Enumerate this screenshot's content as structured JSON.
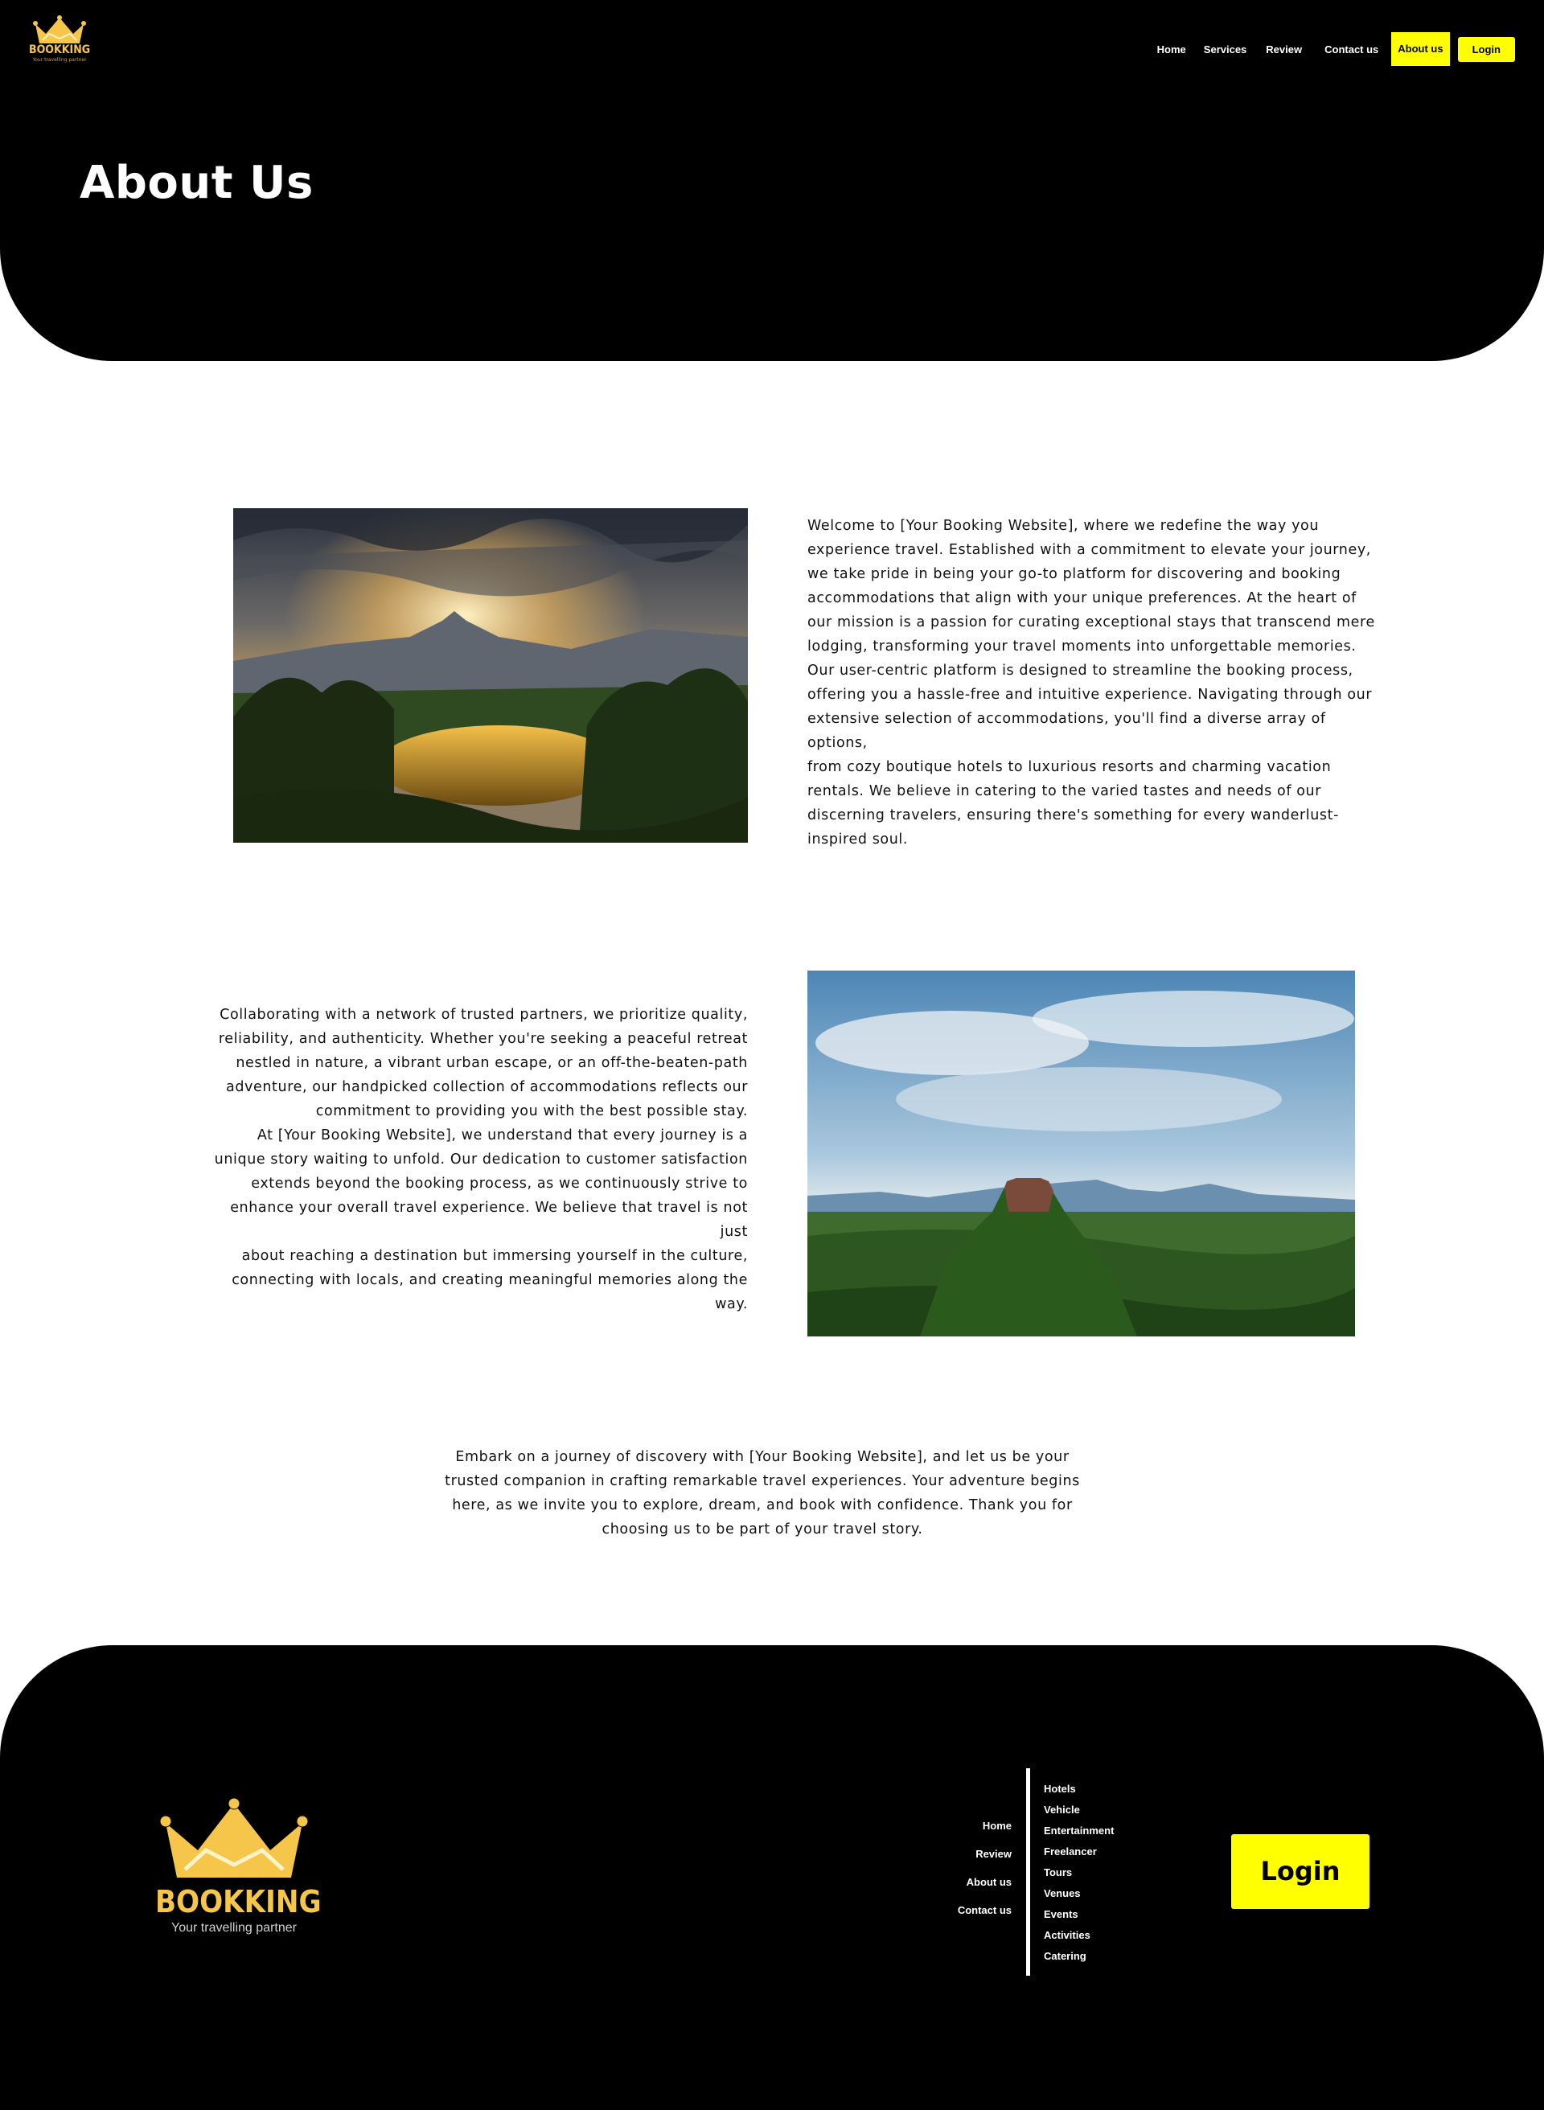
{
  "brand": {
    "name": "BOOKKING",
    "tagline": "Your travelling partner",
    "color": "#f6c64a"
  },
  "nav": {
    "home": "Home",
    "services": "Services",
    "review": "Review",
    "contact": "Contact us",
    "about": "About us",
    "login": "Login",
    "accent": "#ffff00"
  },
  "hero": {
    "title": "About Us"
  },
  "sections": {
    "intro": [
      "Welcome to [Your Booking Website], where we redefine the way you",
      "experience travel. Established with a commitment to elevate your journey,",
      "we take pride in being your go-to platform for discovering and booking",
      "accommodations that align with your unique preferences. At the heart of",
      "our mission is a passion for curating exceptional stays that transcend mere",
      "lodging, transforming your travel moments into unforgettable memories.",
      "Our user-centric platform is designed to streamline the booking process,",
      "offering you a hassle-free and intuitive experience. Navigating through our",
      "extensive selection of accommodations, you'll find a diverse array of options,",
      "from cozy boutique hotels to luxurious resorts and charming vacation",
      "rentals. We believe in catering to the varied tastes and needs of our",
      "discerning travelers, ensuring there's something for every wanderlust-",
      "inspired soul."
    ],
    "partners": [
      "Collaborating with a network of trusted partners, we prioritize quality,",
      "reliability, and authenticity. Whether you're seeking a peaceful retreat",
      "nestled in nature, a vibrant urban escape, or an off-the-beaten-path",
      "adventure, our handpicked collection of accommodations reflects our",
      "commitment to providing you with the best possible stay.",
      "At [Your Booking Website], we understand that every journey is a",
      "unique story waiting to unfold. Our dedication to customer satisfaction",
      "extends beyond the booking process, as we continuously strive to",
      "enhance your overall travel experience. We believe that travel is not just",
      "about reaching a destination but immersing yourself in the culture,",
      "connecting with locals, and creating meaningful memories along the",
      "way."
    ],
    "closing": [
      "Embark on a journey of discovery with [Your Booking Website], and let us be your",
      "trusted companion in crafting remarkable travel experiences. Your adventure begins",
      "here, as we invite you to explore, dream, and book with confidence. Thank you for",
      "choosing us to be part of your travel story."
    ]
  },
  "footer": {
    "left_links": [
      "Home",
      "Review",
      "About us",
      "Contact us"
    ],
    "right_links": [
      "Hotels",
      "Vehicle",
      "Entertainment",
      "Freelancer",
      "Tours",
      "Venues",
      "Events",
      "Activities",
      "Catering"
    ],
    "login": "Login"
  }
}
